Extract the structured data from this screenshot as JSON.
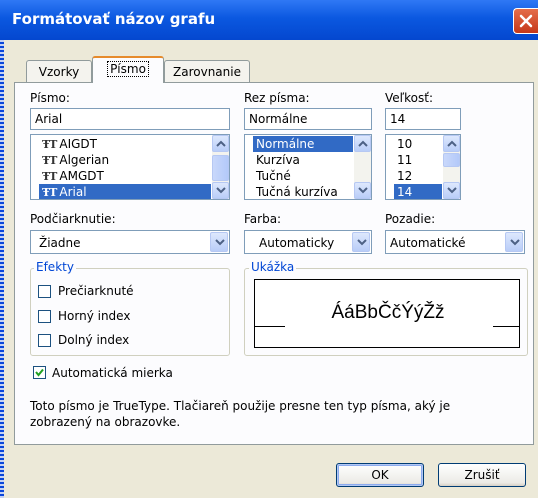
{
  "window": {
    "title": "Formátovať názov grafu",
    "close_label": "close"
  },
  "tabs": [
    {
      "label": "Vzorky"
    },
    {
      "label": "Písmo",
      "active": true
    },
    {
      "label": "Zarovnanie"
    }
  ],
  "font": {
    "label": "Písmo:",
    "value": "Arial",
    "items": [
      "AIGDT",
      "Algerian",
      "AMGDT",
      "Arial"
    ],
    "selected": "Arial"
  },
  "style": {
    "label": "Rez písma:",
    "value": "Normálne",
    "items": [
      "Normálne",
      "Kurzíva",
      "Tučné",
      "Tučná kurzíva"
    ],
    "selected": "Normálne"
  },
  "size": {
    "label": "Veľkosť:",
    "value": "14",
    "items": [
      "10",
      "11",
      "12",
      "14"
    ],
    "selected": "14"
  },
  "underline": {
    "label": "Podčiarknutie:",
    "value": "Žiadne"
  },
  "color": {
    "label": "Farba:",
    "value": "Automaticky"
  },
  "background": {
    "label": "Pozadie:",
    "value": "Automatické"
  },
  "effects": {
    "label": "Efekty",
    "strikethrough": {
      "label": "Prečiarknuté",
      "checked": false
    },
    "superscript": {
      "label": "Horný index",
      "checked": false
    },
    "subscript": {
      "label": "Dolný index",
      "checked": false
    }
  },
  "preview": {
    "label": "Ukážka",
    "text": "ÁáBbČčÝýŽž"
  },
  "autoscale": {
    "label": "Automatická mierka",
    "checked": true
  },
  "info_text": "Toto písmo je TrueType. Tlačiareň použije presne ten typ písma, aký je zobrazený na obrazovke.",
  "buttons": {
    "ok": "OK",
    "cancel": "Zrušiť"
  },
  "colors": {
    "titlebar": "#0b58e0",
    "dialog_bg": "#ece9d8",
    "selection": "#316ac5",
    "group_label": "#0046d5"
  }
}
